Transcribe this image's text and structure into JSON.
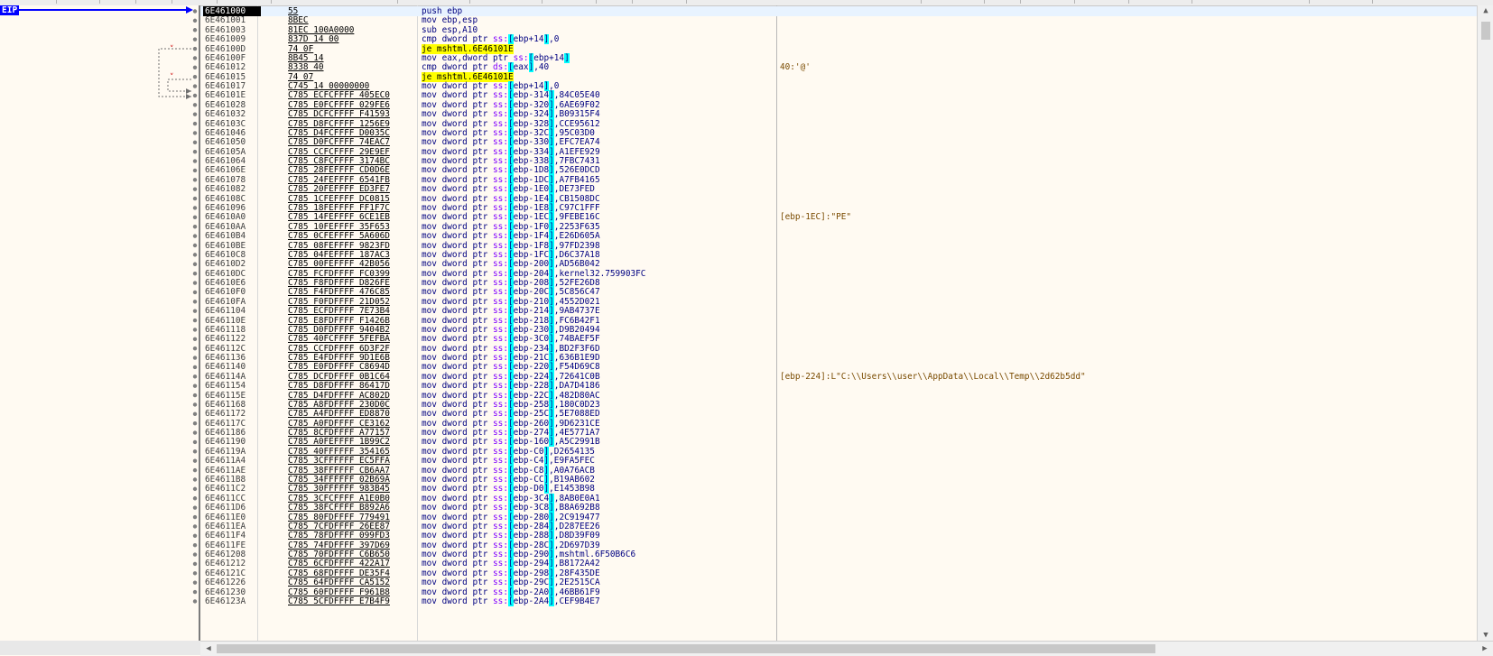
{
  "eip_label": "EIP",
  "rows": [
    {
      "addr": "6E461000",
      "bytes": "55",
      "asm": "push ebp",
      "comment": ""
    },
    {
      "addr": "6E461001",
      "bytes": "8BEC",
      "asm": "mov ebp,esp",
      "comment": ""
    },
    {
      "addr": "6E461003",
      "bytes": "81EC 100A0000",
      "asm": "sub esp,A10",
      "comment": ""
    },
    {
      "addr": "6E461009",
      "bytes": "837D 14 00",
      "asm": "cmp dword ptr ss:[ebp+14],0",
      "comment": ""
    },
    {
      "addr": "6E46100D",
      "bytes": "74 0F",
      "asm": "je mshtml.6E46101E",
      "comment": ""
    },
    {
      "addr": "6E46100F",
      "bytes": "8B45 14",
      "asm": "mov eax,dword ptr ss:[ebp+14]",
      "comment": ""
    },
    {
      "addr": "6E461012",
      "bytes": "8338 40",
      "asm": "cmp dword ptr ds:[eax],40",
      "comment": "40:'@'"
    },
    {
      "addr": "6E461015",
      "bytes": "74 07",
      "asm": "je mshtml.6E46101E",
      "comment": ""
    },
    {
      "addr": "6E461017",
      "bytes": "C745 14 00000000",
      "asm": "mov dword ptr ss:[ebp+14],0",
      "comment": ""
    },
    {
      "addr": "6E46101E",
      "bytes": "C785 ECFCFFFF 405EC0",
      "asm": "mov dword ptr ss:[ebp-314],84C05E40",
      "comment": ""
    },
    {
      "addr": "6E461028",
      "bytes": "C785 E0FCFFFF 029FE6",
      "asm": "mov dword ptr ss:[ebp-320],6AE69F02",
      "comment": ""
    },
    {
      "addr": "6E461032",
      "bytes": "C785 DCFCFFFF F41593",
      "asm": "mov dword ptr ss:[ebp-324],B09315F4",
      "comment": ""
    },
    {
      "addr": "6E46103C",
      "bytes": "C785 D8FCFFFF 1256E9",
      "asm": "mov dword ptr ss:[ebp-328],CCE95612",
      "comment": ""
    },
    {
      "addr": "6E461046",
      "bytes": "C785 D4FCFFFF D0035C",
      "asm": "mov dword ptr ss:[ebp-32C],95C03D0",
      "comment": ""
    },
    {
      "addr": "6E461050",
      "bytes": "C785 D0FCFFFF 74EAC7",
      "asm": "mov dword ptr ss:[ebp-330],EFC7EA74",
      "comment": ""
    },
    {
      "addr": "6E46105A",
      "bytes": "C785 CCFCFFFF 29E9EF",
      "asm": "mov dword ptr ss:[ebp-334],A1EFE929",
      "comment": ""
    },
    {
      "addr": "6E461064",
      "bytes": "C785 C8FCFFFF 3174BC",
      "asm": "mov dword ptr ss:[ebp-338],7FBC7431",
      "comment": ""
    },
    {
      "addr": "6E46106E",
      "bytes": "C785 28FEFFFF CD0D6E",
      "asm": "mov dword ptr ss:[ebp-1D8],526E0DCD",
      "comment": ""
    },
    {
      "addr": "6E461078",
      "bytes": "C785 24FEFFFF 6541FB",
      "asm": "mov dword ptr ss:[ebp-1DC],A7FB4165",
      "comment": ""
    },
    {
      "addr": "6E461082",
      "bytes": "C785 20FEFFFF ED3FE7",
      "asm": "mov dword ptr ss:[ebp-1E0],DE73FED",
      "comment": ""
    },
    {
      "addr": "6E46108C",
      "bytes": "C785 1CFEFFFF DC0815",
      "asm": "mov dword ptr ss:[ebp-1E4],CB1508DC",
      "comment": ""
    },
    {
      "addr": "6E461096",
      "bytes": "C785 18FEFFFF FF1F7C",
      "asm": "mov dword ptr ss:[ebp-1E8],C97C1FFF",
      "comment": ""
    },
    {
      "addr": "6E4610A0",
      "bytes": "C785 14FEFFFF 6CE1EB",
      "asm": "mov dword ptr ss:[ebp-1EC],9FEBE16C",
      "comment": "[ebp-1EC]:\"PE\""
    },
    {
      "addr": "6E4610AA",
      "bytes": "C785 10FEFFFF 35F653",
      "asm": "mov dword ptr ss:[ebp-1F0],2253F635",
      "comment": ""
    },
    {
      "addr": "6E4610B4",
      "bytes": "C785 0CFEFFFF 5A606D",
      "asm": "mov dword ptr ss:[ebp-1F4],E26D605A",
      "comment": ""
    },
    {
      "addr": "6E4610BE",
      "bytes": "C785 08FEFFFF 9823FD",
      "asm": "mov dword ptr ss:[ebp-1F8],97FD2398",
      "comment": ""
    },
    {
      "addr": "6E4610C8",
      "bytes": "C785 04FEFFFF 187AC3",
      "asm": "mov dword ptr ss:[ebp-1FC],D6C37A18",
      "comment": ""
    },
    {
      "addr": "6E4610D2",
      "bytes": "C785 00FEFFFF 42B056",
      "asm": "mov dword ptr ss:[ebp-200],AD56B042",
      "comment": ""
    },
    {
      "addr": "6E4610DC",
      "bytes": "C785 FCFDFFFF FC0399",
      "asm": "mov dword ptr ss:[ebp-204],kernel32.759903FC",
      "comment": ""
    },
    {
      "addr": "6E4610E6",
      "bytes": "C785 F8FDFFFF D826FE",
      "asm": "mov dword ptr ss:[ebp-208],52FE26D8",
      "comment": ""
    },
    {
      "addr": "6E4610F0",
      "bytes": "C785 F4FDFFFF 476C85",
      "asm": "mov dword ptr ss:[ebp-20C],5C856C47",
      "comment": ""
    },
    {
      "addr": "6E4610FA",
      "bytes": "C785 F0FDFFFF 21D052",
      "asm": "mov dword ptr ss:[ebp-210],4552D021",
      "comment": ""
    },
    {
      "addr": "6E461104",
      "bytes": "C785 ECFDFFFF 7E73B4",
      "asm": "mov dword ptr ss:[ebp-214],9AB4737E",
      "comment": ""
    },
    {
      "addr": "6E46110E",
      "bytes": "C785 E8FDFFFF F1426B",
      "asm": "mov dword ptr ss:[ebp-218],FC6B42F1",
      "comment": ""
    },
    {
      "addr": "6E461118",
      "bytes": "C785 D0FDFFFF 9404B2",
      "asm": "mov dword ptr ss:[ebp-230],D9B20494",
      "comment": ""
    },
    {
      "addr": "6E461122",
      "bytes": "C785 40FCFFFF 5FEFBA",
      "asm": "mov dword ptr ss:[ebp-3C0],74BAEF5F",
      "comment": ""
    },
    {
      "addr": "6E46112C",
      "bytes": "C785 CCFDFFFF 6D3F2F",
      "asm": "mov dword ptr ss:[ebp-234],BD2F3F6D",
      "comment": ""
    },
    {
      "addr": "6E461136",
      "bytes": "C785 E4FDFFFF 9D1E6B",
      "asm": "mov dword ptr ss:[ebp-21C],636B1E9D",
      "comment": ""
    },
    {
      "addr": "6E461140",
      "bytes": "C785 E0FDFFFF C8694D",
      "asm": "mov dword ptr ss:[ebp-220],F54D69C8",
      "comment": ""
    },
    {
      "addr": "6E46114A",
      "bytes": "C785 DCFDFFFF 0B1C64",
      "asm": "mov dword ptr ss:[ebp-224],72641C0B",
      "comment": "[ebp-224]:L\"C:\\\\Users\\\\user\\\\AppData\\\\Local\\\\Temp\\\\2d62b5dd\""
    },
    {
      "addr": "6E461154",
      "bytes": "C785 D8FDFFFF 86417D",
      "asm": "mov dword ptr ss:[ebp-228],DA7D4186",
      "comment": ""
    },
    {
      "addr": "6E46115E",
      "bytes": "C785 D4FDFFFF AC802D",
      "asm": "mov dword ptr ss:[ebp-22C],482D80AC",
      "comment": ""
    },
    {
      "addr": "6E461168",
      "bytes": "C785 A8FDFFFF 230D0C",
      "asm": "mov dword ptr ss:[ebp-258],180C0D23",
      "comment": ""
    },
    {
      "addr": "6E461172",
      "bytes": "C785 A4FDFFFF ED8870",
      "asm": "mov dword ptr ss:[ebp-25C],5E7088ED",
      "comment": ""
    },
    {
      "addr": "6E46117C",
      "bytes": "C785 A0FDFFFF CE3162",
      "asm": "mov dword ptr ss:[ebp-260],9D6231CE",
      "comment": ""
    },
    {
      "addr": "6E461186",
      "bytes": "C785 8CFDFFFF A77157",
      "asm": "mov dword ptr ss:[ebp-274],4E5771A7",
      "comment": ""
    },
    {
      "addr": "6E461190",
      "bytes": "C785 A0FEFFFF 1B99C2",
      "asm": "mov dword ptr ss:[ebp-160],A5C2991B",
      "comment": ""
    },
    {
      "addr": "6E46119A",
      "bytes": "C785 40FFFFFF 354165",
      "asm": "mov dword ptr ss:[ebp-C0],D2654135",
      "comment": ""
    },
    {
      "addr": "6E4611A4",
      "bytes": "C785 3CFFFFFF EC5FFA",
      "asm": "mov dword ptr ss:[ebp-C4],E9FA5FEC",
      "comment": ""
    },
    {
      "addr": "6E4611AE",
      "bytes": "C785 38FFFFFF CB6AA7",
      "asm": "mov dword ptr ss:[ebp-C8],A0A76ACB",
      "comment": ""
    },
    {
      "addr": "6E4611B8",
      "bytes": "C785 34FFFFFF 02B69A",
      "asm": "mov dword ptr ss:[ebp-CC],B19AB602",
      "comment": ""
    },
    {
      "addr": "6E4611C2",
      "bytes": "C785 30FFFFFF 983B45",
      "asm": "mov dword ptr ss:[ebp-D0],E1453B98",
      "comment": ""
    },
    {
      "addr": "6E4611CC",
      "bytes": "C785 3CFCFFFF A1E0B0",
      "asm": "mov dword ptr ss:[ebp-3C4],8AB0E0A1",
      "comment": ""
    },
    {
      "addr": "6E4611D6",
      "bytes": "C785 38FCFFFF B892A6",
      "asm": "mov dword ptr ss:[ebp-3C8],B8A692B8",
      "comment": ""
    },
    {
      "addr": "6E4611E0",
      "bytes": "C785 80FDFFFF 779491",
      "asm": "mov dword ptr ss:[ebp-280],2C919477",
      "comment": ""
    },
    {
      "addr": "6E4611EA",
      "bytes": "C785 7CFDFFFF 26EE87",
      "asm": "mov dword ptr ss:[ebp-284],D287EE26",
      "comment": ""
    },
    {
      "addr": "6E4611F4",
      "bytes": "C785 78FDFFFF 099FD3",
      "asm": "mov dword ptr ss:[ebp-288],D8D39F09",
      "comment": ""
    },
    {
      "addr": "6E4611FE",
      "bytes": "C785 74FDFFFF 397D69",
      "asm": "mov dword ptr ss:[ebp-28C],2D697D39",
      "comment": ""
    },
    {
      "addr": "6E461208",
      "bytes": "C785 70FDFFFF C6B650",
      "asm": "mov dword ptr ss:[ebp-290],mshtml.6F50B6C6",
      "comment": ""
    },
    {
      "addr": "6E461212",
      "bytes": "C785 6CFDFFFF 422A17",
      "asm": "mov dword ptr ss:[ebp-294],B8172A42",
      "comment": ""
    },
    {
      "addr": "6E46121C",
      "bytes": "C785 68FDFFFF DE35F4",
      "asm": "mov dword ptr ss:[ebp-298],28F435DE",
      "comment": ""
    },
    {
      "addr": "6E461226",
      "bytes": "C785 64FDFFFF CA5152",
      "asm": "mov dword ptr ss:[ebp-29C],2E2515CA",
      "comment": ""
    },
    {
      "addr": "6E461230",
      "bytes": "C785 60FDFFFF F961B8",
      "asm": "mov dword ptr ss:[ebp-2A0],46BB61F9",
      "comment": ""
    },
    {
      "addr": "6E46123A",
      "bytes": "C785 5CFDFFFF E7B4F9",
      "asm": "mov dword ptr ss:[ebp-2A4],CEF9B4E7",
      "comment": ""
    }
  ],
  "colors": {
    "background": "#fffaf2",
    "current_address_bg": "#000000",
    "eip_label_bg": "#0000ff",
    "jump_highlight": "#ffff00",
    "register_highlight": "#00ffff",
    "ss_segment": "#8000ff",
    "comment": "#7a4b00"
  }
}
